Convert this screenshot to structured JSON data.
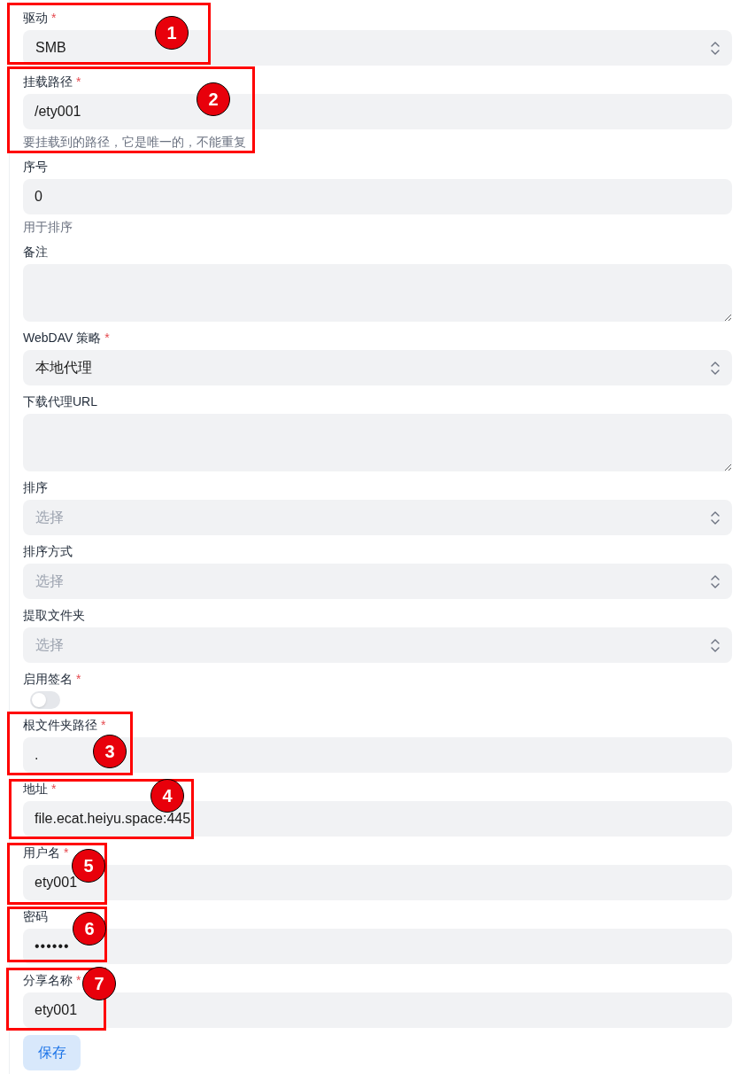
{
  "form": {
    "fields": [
      {
        "kind": "select",
        "label": "驱动",
        "required_mark": "*",
        "value": "SMB"
      },
      {
        "kind": "input",
        "label": "挂载路径",
        "required_mark": "*",
        "value": "/ety001",
        "help": "要挂载到的路径，它是唯一的，不能重复"
      },
      {
        "kind": "input",
        "label": "序号",
        "value": "0",
        "help": "用于排序"
      },
      {
        "kind": "textarea",
        "label": "备注"
      },
      {
        "kind": "select",
        "label": "WebDAV 策略",
        "required_mark": "*",
        "value": "本地代理"
      },
      {
        "kind": "textarea",
        "label": "下载代理URL"
      },
      {
        "kind": "select",
        "label": "排序",
        "placeholder": "选择"
      },
      {
        "kind": "select",
        "label": "排序方式",
        "placeholder": "选择"
      },
      {
        "kind": "select",
        "label": "提取文件夹",
        "placeholder": "选择"
      },
      {
        "kind": "switch",
        "label": "启用签名",
        "required_mark": "*",
        "on": false
      },
      {
        "kind": "input",
        "label": "根文件夹路径",
        "required_mark": "*",
        "value": "."
      },
      {
        "kind": "input",
        "label": "地址",
        "required_mark": "*",
        "value": "file.ecat.heiyu.space:445"
      },
      {
        "kind": "input",
        "label": "用户名",
        "required_mark": "*",
        "value": "ety001"
      },
      {
        "kind": "password",
        "label": "密码",
        "value": "••••••"
      },
      {
        "kind": "input",
        "label": "分享名称",
        "required_mark": "*",
        "value": "ety001"
      }
    ],
    "submit": {
      "label": "保存"
    }
  },
  "annotations": [
    {
      "number": "1"
    },
    {
      "number": "2"
    },
    {
      "number": "3"
    },
    {
      "number": "4"
    },
    {
      "number": "5"
    },
    {
      "number": "6"
    },
    {
      "number": "7"
    }
  ]
}
